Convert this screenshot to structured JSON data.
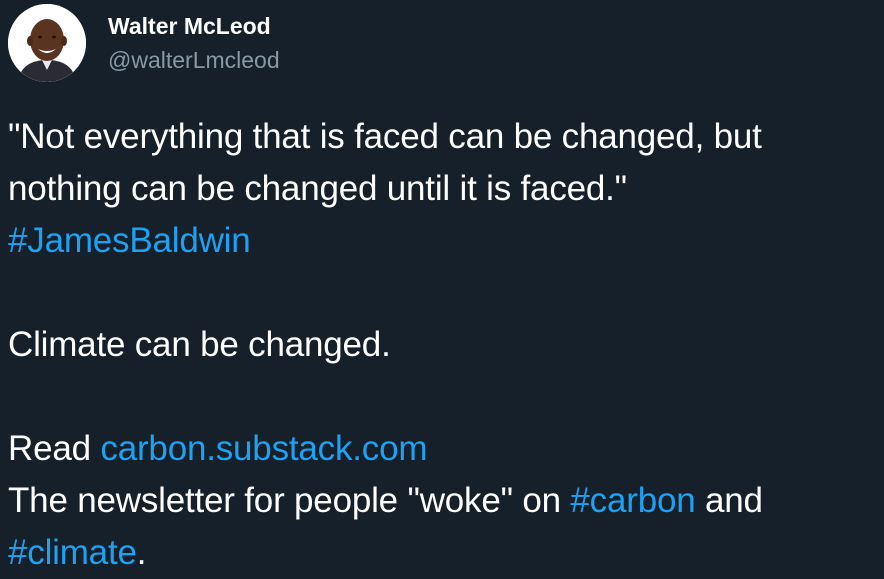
{
  "author": {
    "display_name": "Walter McLeod",
    "handle": "@walterLmcleod",
    "avatar_icon": "profile-photo"
  },
  "tweet": {
    "quote_line1": "\"Not everything that is faced can be changed, but",
    "quote_line2": "nothing can be changed until it is faced.\"",
    "hashtag_baldwin": "#JamesBaldwin",
    "climate_line": "Climate can be changed.",
    "read_prefix": "Read ",
    "read_link": "carbon.substack.com",
    "newsletter_prefix": "The newsletter for people \"woke\" on ",
    "hashtag_carbon": "#carbon",
    "newsletter_and": " and",
    "hashtag_climate": "#climate",
    "final_period": "."
  },
  "colors": {
    "background": "#15202b",
    "text": "#ffffff",
    "secondary_text": "#8899a6",
    "link": "#1da1f2"
  }
}
